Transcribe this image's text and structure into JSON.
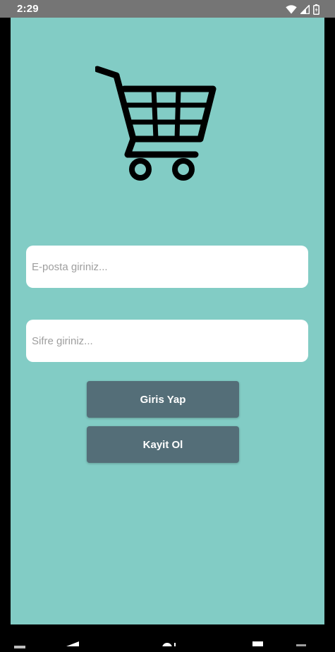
{
  "status_bar": {
    "time": "2:29",
    "icons": [
      "wifi-icon",
      "signal-icon",
      "battery-icon"
    ]
  },
  "logo": {
    "icon": "shopping-cart-icon"
  },
  "login_form": {
    "email_placeholder": "E-posta giriniz...",
    "password_placeholder": "Sifre giriniz...",
    "login_label": "Giris Yap",
    "register_label": "Kayit Ol"
  },
  "nav_bar": {
    "icons": [
      "back-icon",
      "home-icon",
      "recents-icon"
    ]
  },
  "colors": {
    "background": "#82ccc5",
    "button": "#546e78",
    "status_bar": "#757575",
    "field": "#ffffff"
  }
}
